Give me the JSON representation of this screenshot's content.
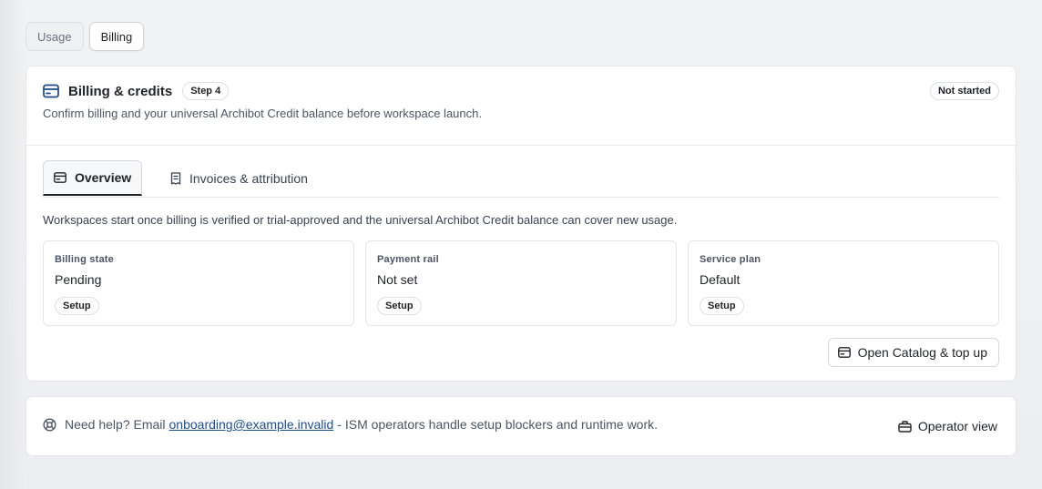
{
  "top_tabs": [
    {
      "label": "Usage",
      "active": false
    },
    {
      "label": "Billing",
      "active": true
    }
  ],
  "billing_card": {
    "title": "Billing & credits",
    "step_badge": "Step 4",
    "status_badge": "Not started",
    "subtitle": "Confirm billing and your universal Archibot Credit balance before workspace launch.",
    "tabs": [
      {
        "label": "Overview",
        "icon": "layout-card-icon",
        "active": true
      },
      {
        "label": "Invoices & attribution",
        "icon": "receipt-icon",
        "active": false
      }
    ],
    "description": "Workspaces start once billing is verified or trial-approved and the universal Archibot Credit balance can cover new usage.",
    "stats": [
      {
        "label": "Billing state",
        "value": "Pending",
        "pill": "Setup"
      },
      {
        "label": "Payment rail",
        "value": "Not set",
        "pill": "Setup"
      },
      {
        "label": "Service plan",
        "value": "Default",
        "pill": "Setup"
      }
    ],
    "catalog_button": "Open Catalog & top up"
  },
  "help_card": {
    "prefix": "Need help? Email",
    "email": "onboarding@example.invalid",
    "suffix": "- ISM operators handle setup blockers and runtime work.",
    "operator_button": "Operator view"
  },
  "colors": {
    "accent_link": "#1f4e8c",
    "title_icon": "#1f4e8c"
  }
}
